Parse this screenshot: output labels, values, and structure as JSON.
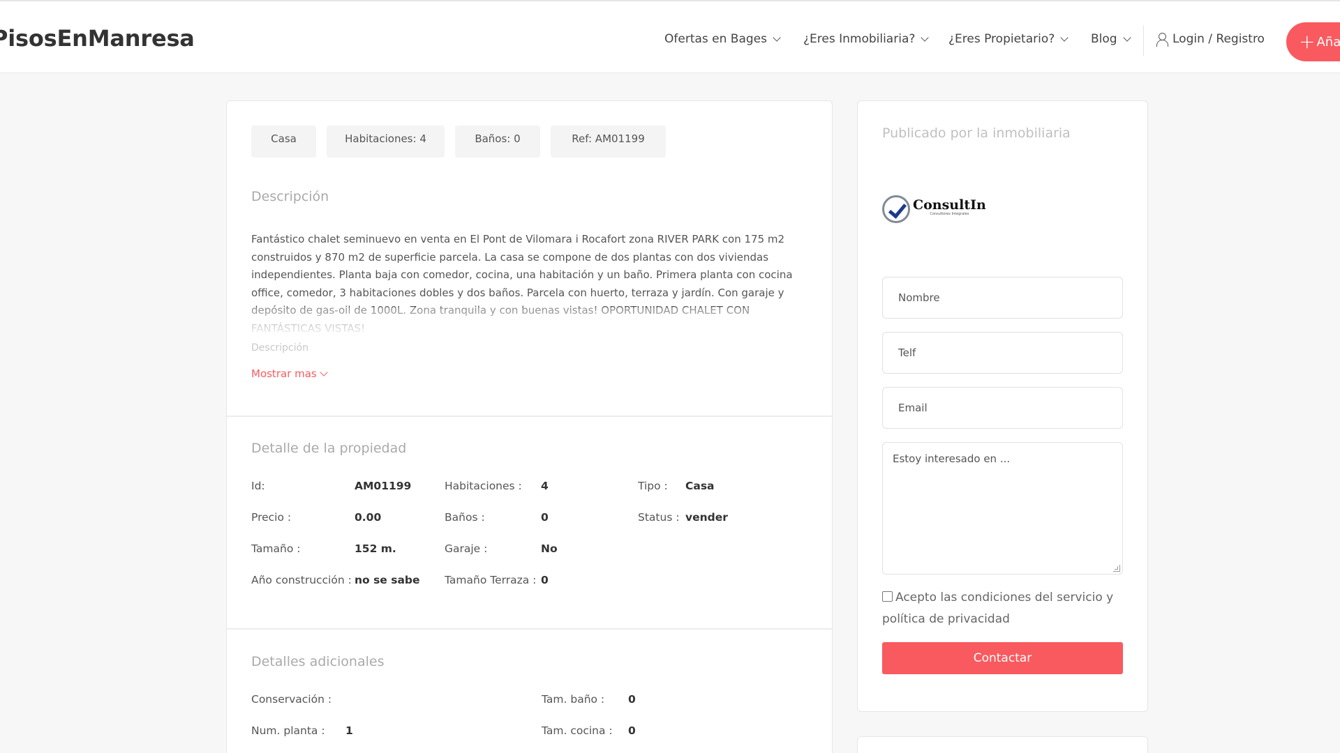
{
  "header": {
    "brand": "PisosEnManresa",
    "nav": [
      {
        "label": "Ofertas en Bages"
      },
      {
        "label": "¿Eres Inmobiliaria?"
      },
      {
        "label": "¿Eres Propietario?"
      },
      {
        "label": "Blog"
      }
    ],
    "login_label": "Login / Registro",
    "add_label": "Añadir"
  },
  "tags": [
    "Casa",
    "Habitaciones: 4",
    "Baños: 0",
    "Ref: AM01199"
  ],
  "description": {
    "title": "Descripción",
    "text": "Fantástico chalet seminuevo en venta en El Pont de Vilomara i Rocafort zona RIVER PARK con 175 m2 construidos y 870 m2 de superficie parcela. La casa se compone de dos plantas con dos viviendas independientes. Planta baja con comedor, cocina, una habitación y un baño. Primera planta con cocina office, comedor, 3 habitaciones dobles y dos baños. Parcela con huerto, terraza y jardín. Con garaje y depósito de gas-oil de 1000L. Zona tranquila y con buenas vistas! OPORTUNIDAD CHALET CON FANTÁSTICAS VISTAS!",
    "small_label": "Descripción",
    "more_label": "Mostrar mas"
  },
  "details": {
    "title": "Detalle de la propiedad",
    "id_label": "Id:",
    "id_value": "AM01199",
    "rooms_label": "Habitaciones :",
    "rooms_value": "4",
    "type_label": "Tipo :",
    "type_value": "Casa",
    "price_label": "Precio :",
    "price_value": "0.00",
    "baths_label": "Baños :",
    "baths_value": "0",
    "status_label": "Status :",
    "status_value": "vender",
    "size_label": "Tamaño :",
    "size_value": "152 m.",
    "garage_label": "Garaje :",
    "garage_value": "No",
    "year_label": "Año construcción :",
    "year_value": "no se sabe",
    "terrace_label": "Tamaño Terraza :",
    "terrace_value": "0"
  },
  "additional": {
    "title": "Detalles adicionales",
    "conservation_label": "Conservación :",
    "conservation_value": "",
    "bath_size_label": "Tam. baño :",
    "bath_size_value": "0",
    "floor_label": "Num. planta :",
    "floor_value": "1",
    "kitchen_size_label": "Tam. cocina :",
    "kitchen_size_value": "0"
  },
  "sidebar": {
    "title": "Publicado por la inmobiliaria",
    "logo_name": "ConsultIn",
    "logo_sub": "Consultores Integrales",
    "name_placeholder": "Nombre",
    "phone_placeholder": "Telf",
    "email_placeholder": "Email",
    "message_placeholder": "Estoy interesado en ...",
    "terms_label": "Acepto las condiciones del servicio y política de privacidad",
    "submit_label": "Contactar"
  },
  "colors": {
    "accent": "#f95a5f",
    "background": "#f7f7f7"
  }
}
